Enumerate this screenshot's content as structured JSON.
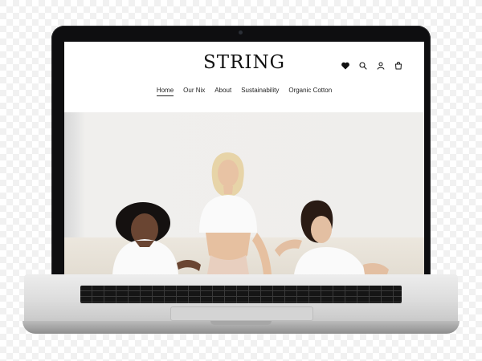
{
  "site": {
    "logo": "STRING",
    "nav": [
      {
        "label": "Home",
        "active": true
      },
      {
        "label": "Our Nix",
        "active": false
      },
      {
        "label": "About",
        "active": false
      },
      {
        "label": "Sustainability",
        "active": false
      },
      {
        "label": "Organic Cotton",
        "active": false
      }
    ],
    "header_icons": [
      "heart-icon",
      "search-icon",
      "account-icon",
      "cart-icon"
    ]
  },
  "colors": {
    "text": "#111111",
    "bezel": "#0e0e10",
    "hero_background": "#efeeec"
  }
}
